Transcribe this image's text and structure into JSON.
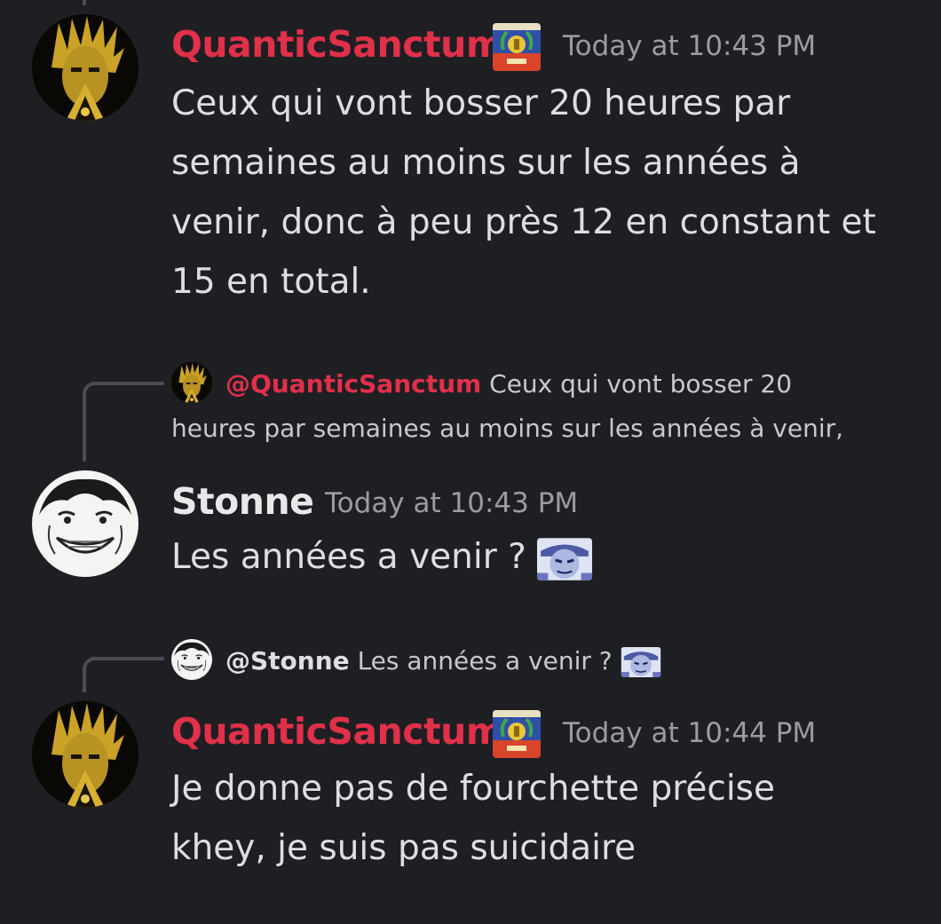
{
  "messages": [
    {
      "username": "QuanticSanctum",
      "timestamp": "Today at 10:43 PM",
      "text_lines": [
        "Ceux qui vont bosser 20 heures par",
        "semaines au moins sur les années à",
        "venir, donc à peu près 12 en constant et",
        "15 en total."
      ],
      "avatar": "anime-character-avatar",
      "badge": "crest-badge-icon"
    },
    {
      "reply": {
        "mention": "@QuanticSanctum",
        "line1": "Ceux qui vont bosser 20",
        "line2": "heures par semaines au moins sur les années à venir,"
      },
      "username": "Stonne",
      "timestamp": "Today at 10:43 PM",
      "text": "Les années a venir ?",
      "emoji": "face-emoji",
      "avatar": "manga-face-avatar"
    },
    {
      "reply": {
        "mention": "@Stonne",
        "text": "Les années a venir ?"
      },
      "username": "QuanticSanctum",
      "timestamp": "Today at 10:44 PM",
      "text_lines": [
        "Je donne pas de fourchette précise",
        "khey, je suis pas suicidaire"
      ],
      "avatar": "anime-character-avatar",
      "badge": "crest-badge-icon"
    }
  ],
  "colors": {
    "background": "#1e1f23",
    "username_red": "#e0304a",
    "text": "#dcdee2",
    "muted": "#9a9ca3"
  }
}
